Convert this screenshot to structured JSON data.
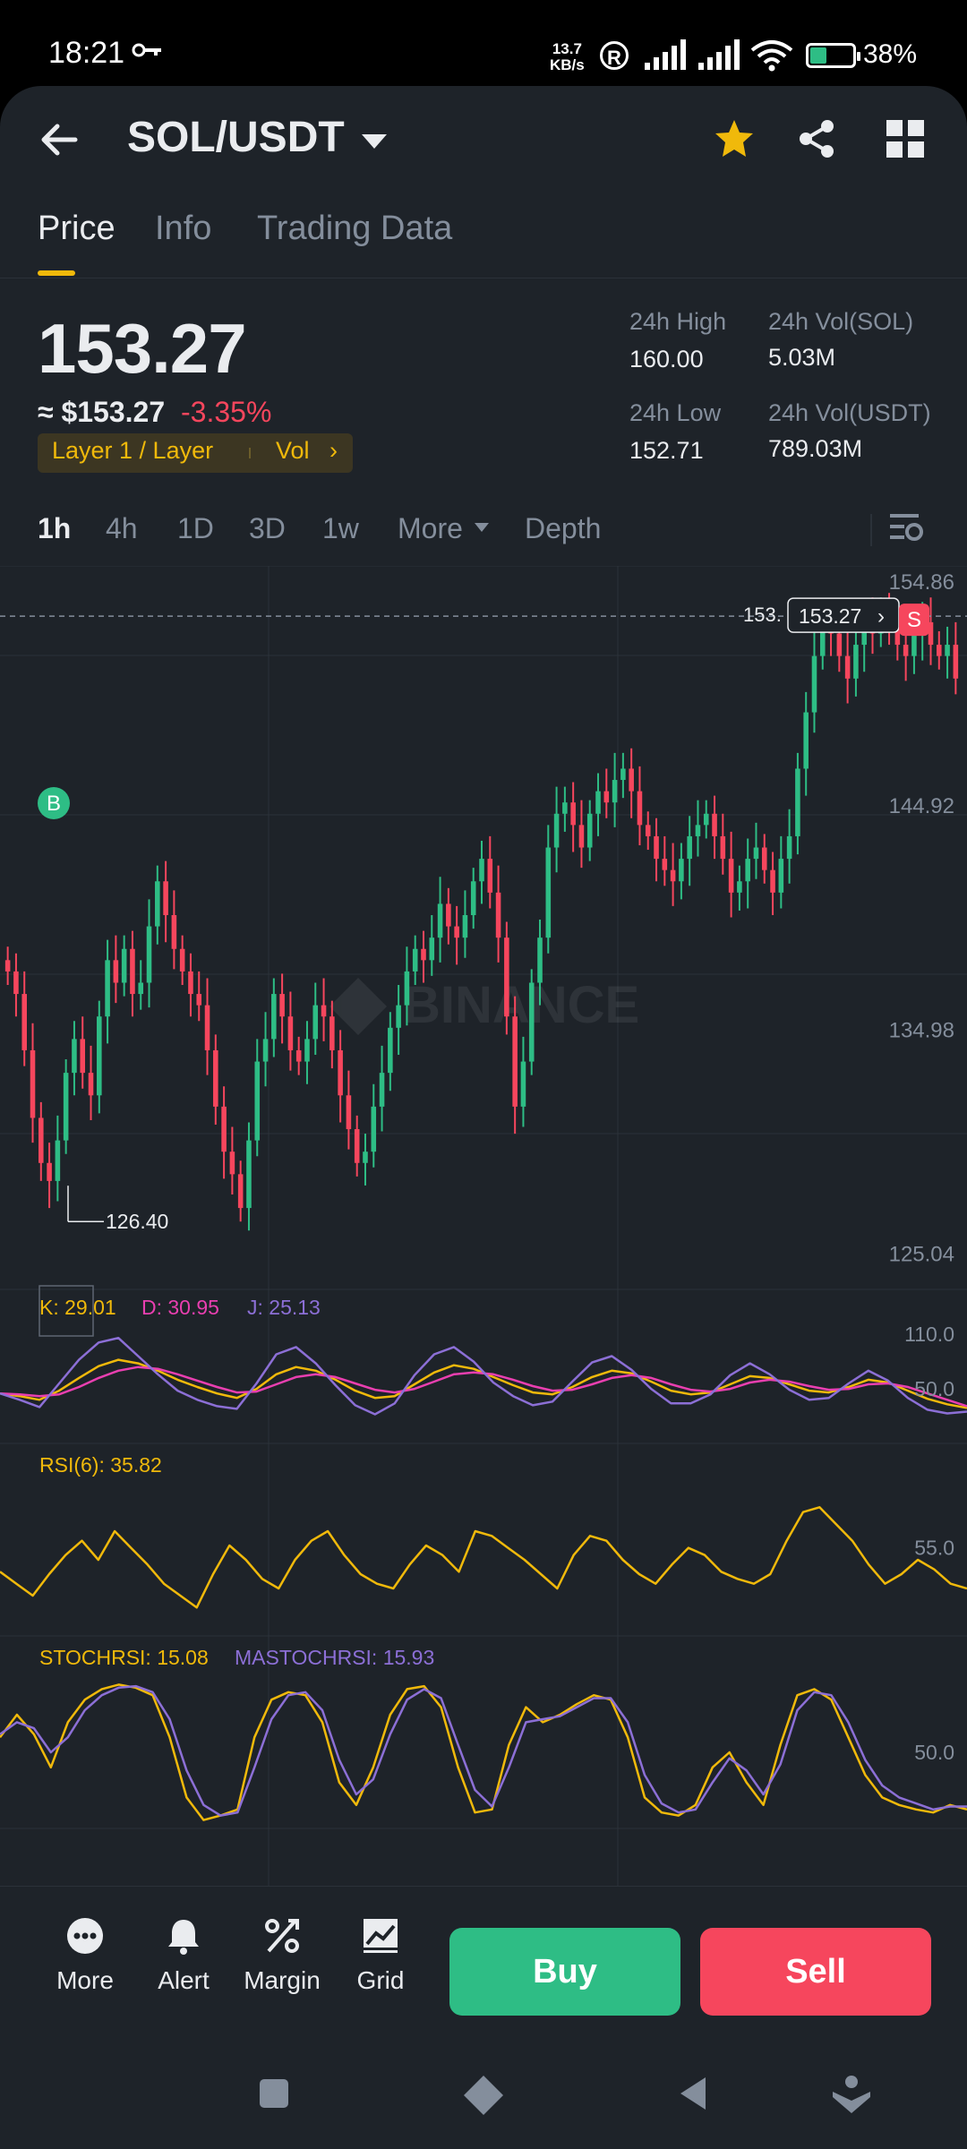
{
  "status_bar": {
    "time": "18:21",
    "speed_value": "13.7",
    "speed_unit": "KB/s",
    "battery_pct": "38%"
  },
  "header": {
    "pair": "SOL/USDT"
  },
  "tabs": [
    {
      "label": "Price",
      "active": true
    },
    {
      "label": "Info",
      "active": false
    },
    {
      "label": "Trading Data",
      "active": false
    }
  ],
  "ticker": {
    "last_price": "153.27",
    "approx_usd": "≈ $153.27",
    "change_pct": "-3.35%",
    "tag_category": "Layer 1 / Layer",
    "tag_vol": "Vol",
    "high_label": "24h High",
    "high_value": "160.00",
    "low_label": "24h Low",
    "low_value": "152.71",
    "vol_base_label": "24h Vol(SOL)",
    "vol_base_value": "5.03M",
    "vol_quote_label": "24h Vol(USDT)",
    "vol_quote_value": "789.03M"
  },
  "timeframes": {
    "items": [
      "1h",
      "4h",
      "1D",
      "3D",
      "1w"
    ],
    "active": "1h",
    "more": "More",
    "depth": "Depth"
  },
  "chart_data": [
    {
      "type": "candlestick",
      "title": "",
      "y_ticks": [
        "154.86",
        "144.92",
        "134.98",
        "125.04"
      ],
      "ylim": [
        124.5,
        155.5
      ],
      "current_price_label": "153.27",
      "current_price_left_label": "153.",
      "low_marker": "126.40",
      "buy_marker": "B",
      "sell_marker": "S",
      "watermark": "BINANCE",
      "closes": [
        137.5,
        136.5,
        134.0,
        131.0,
        129.0,
        128.2,
        130.0,
        133.0,
        134.5,
        133.0,
        132.0,
        135.5,
        138.0,
        137.0,
        138.5,
        136.5,
        137.0,
        139.5,
        141.5,
        140.0,
        138.5,
        137.5,
        136.5,
        136.0,
        134.0,
        131.5,
        129.5,
        128.5,
        127.0,
        130.0,
        133.5,
        134.5,
        136.5,
        135.5,
        134.0,
        133.5,
        134.5,
        136.0,
        135.5,
        134.0,
        132.0,
        130.5,
        129.0,
        129.5,
        131.5,
        133.0,
        135.0,
        136.0,
        137.5,
        138.5,
        138.0,
        139.0,
        140.5,
        139.5,
        139.0,
        140.0,
        141.5,
        142.5,
        141.0,
        139.0,
        135.5,
        131.5,
        133.5,
        137.0,
        139.0,
        143.0,
        144.5,
        145.0,
        144.0,
        143.0,
        144.5,
        145.5,
        145.0,
        146.0,
        146.5,
        145.5,
        144.0,
        143.5,
        142.5,
        142.0,
        141.5,
        142.5,
        143.5,
        144.0,
        144.5,
        143.5,
        142.5,
        141.0,
        141.5,
        142.5,
        143.0,
        142.0,
        141.0,
        142.5,
        143.5,
        146.5,
        149.0,
        151.5,
        153.0,
        152.5,
        151.5,
        150.5,
        152.0,
        153.0,
        152.5,
        153.5,
        153.0,
        152.0,
        151.5,
        152.5,
        153.0,
        152.0,
        151.5,
        152.0,
        150.5
      ],
      "x_count": 115
    },
    {
      "type": "line",
      "title": "",
      "legend": [
        {
          "name": "K",
          "value": "29.01",
          "color": "#F0B90B"
        },
        {
          "name": "D",
          "value": "30.95",
          "color": "#E93FB0"
        },
        {
          "name": "J",
          "value": "25.13",
          "color": "#8C6FD6"
        }
      ],
      "y_ticks": [
        "110.0",
        "50.0"
      ],
      "ylim": [
        -10,
        120
      ],
      "series": [
        {
          "name": "K",
          "values": [
            45,
            42,
            38,
            48,
            62,
            75,
            82,
            78,
            70,
            60,
            52,
            45,
            40,
            50,
            66,
            74,
            70,
            60,
            48,
            40,
            42,
            55,
            68,
            76,
            72,
            63,
            54,
            46,
            44,
            52,
            63,
            70,
            67,
            58,
            48,
            44,
            46,
            55,
            64,
            62,
            55,
            48,
            46,
            52,
            60,
            57,
            48,
            39,
            33,
            29
          ]
        },
        {
          "name": "D",
          "values": [
            45,
            44,
            42,
            44,
            52,
            62,
            70,
            74,
            72,
            66,
            59,
            52,
            46,
            47,
            55,
            63,
            66,
            63,
            56,
            49,
            46,
            50,
            58,
            66,
            68,
            66,
            60,
            53,
            48,
            49,
            55,
            62,
            65,
            62,
            55,
            49,
            47,
            50,
            57,
            60,
            58,
            53,
            49,
            50,
            55,
            56,
            52,
            45,
            38,
            31
          ]
        },
        {
          "name": "J",
          "values": [
            45,
            38,
            30,
            56,
            82,
            101,
            106,
            86,
            66,
            48,
            38,
            31,
            28,
            56,
            88,
            96,
            78,
            54,
            32,
            22,
            34,
            65,
            88,
            96,
            80,
            57,
            42,
            32,
            36,
            58,
            79,
            86,
            71,
            50,
            34,
            34,
            44,
            65,
            78,
            66,
            49,
            38,
            40,
            56,
            70,
            59,
            40,
            27,
            23,
            25
          ]
        }
      ]
    },
    {
      "type": "line",
      "title": "",
      "legend": [
        {
          "name": "RSI(6)",
          "value": "35.82",
          "color": "#F0B90B"
        }
      ],
      "y_ticks": [
        "55.0"
      ],
      "ylim": [
        20,
        80
      ],
      "series": [
        {
          "name": "RSI(6)",
          "values": [
            45,
            40,
            35,
            44,
            52,
            58,
            50,
            62,
            55,
            48,
            40,
            35,
            30,
            44,
            56,
            50,
            42,
            38,
            50,
            58,
            62,
            52,
            44,
            40,
            38,
            48,
            56,
            52,
            45,
            62,
            60,
            55,
            50,
            44,
            38,
            52,
            60,
            58,
            50,
            44,
            40,
            48,
            55,
            52,
            45,
            42,
            40,
            44,
            58,
            70,
            72,
            65,
            58,
            48,
            40,
            44,
            50,
            46,
            40,
            38
          ]
        }
      ]
    },
    {
      "type": "line",
      "title": "",
      "legend": [
        {
          "name": "STOCHRSI",
          "value": "15.08",
          "color": "#F0B90B"
        },
        {
          "name": "MASTOCHRSI",
          "value": "15.93",
          "color": "#8C6FD6"
        }
      ],
      "y_ticks": [
        "50.0"
      ],
      "ylim": [
        0,
        100
      ],
      "series": [
        {
          "name": "STOCHRSI",
          "values": [
            60,
            75,
            62,
            40,
            70,
            85,
            92,
            95,
            93,
            88,
            60,
            20,
            5,
            8,
            12,
            60,
            85,
            90,
            88,
            70,
            30,
            15,
            40,
            75,
            92,
            94,
            80,
            40,
            10,
            12,
            55,
            80,
            70,
            75,
            82,
            88,
            85,
            60,
            20,
            10,
            8,
            15,
            40,
            50,
            30,
            15,
            55,
            88,
            92,
            85,
            60,
            35,
            20,
            15,
            12,
            10,
            15,
            12
          ]
        },
        {
          "name": "MASTOCHRSI",
          "values": [
            62,
            70,
            66,
            50,
            60,
            78,
            88,
            93,
            94,
            90,
            72,
            38,
            15,
            8,
            10,
            40,
            72,
            88,
            90,
            78,
            45,
            22,
            32,
            62,
            85,
            92,
            86,
            55,
            25,
            14,
            40,
            70,
            72,
            74,
            80,
            86,
            86,
            70,
            35,
            16,
            10,
            12,
            30,
            46,
            38,
            22,
            42,
            78,
            90,
            88,
            70,
            45,
            28,
            20,
            16,
            12,
            14,
            14
          ]
        }
      ]
    }
  ],
  "bottom_bar": {
    "more": "More",
    "alert": "Alert",
    "margin": "Margin",
    "grid": "Grid",
    "buy": "Buy",
    "sell": "Sell"
  },
  "colors": {
    "bg": "#1E2329",
    "up": "#2EBD85",
    "down": "#F6465D",
    "accent": "#F0B90B",
    "text_secondary": "#848E9C"
  }
}
